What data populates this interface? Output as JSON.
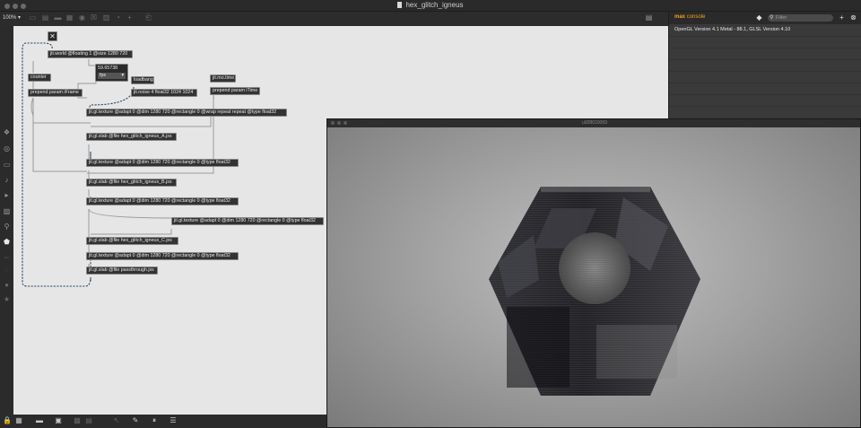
{
  "window": {
    "title": "hex_glitch_igneus"
  },
  "toolbar": {
    "zoom": "100%",
    "icons": [
      "lock-icon",
      "new-object-icon",
      "comment-icon",
      "message-icon",
      "number-icon",
      "bang-icon",
      "toggle-icon",
      "slider-icon",
      "dial-icon",
      "add-icon",
      "present-icon",
      "sidebar-icon"
    ]
  },
  "patcher": {
    "close_glyph": "✕",
    "objects": {
      "world": "jit.world @floating 1 @size 1280 720",
      "counter": "counter",
      "prepend_iframe": "prepend param iFrame",
      "number_value": "59.65738",
      "number_menu": "fps",
      "loadbang": "loadbang",
      "noise": "jit.noise 4 float32 1024 1024",
      "mo_time": "jit.mo.time",
      "prepend_itime": "prepend param iTime",
      "tex_wrap": "jit.gl.texture @adapt 0 @dim 1280 720 @rectangle 0 @wrap repeat repeat @type float32",
      "slab_a": "jit.gl.slab @file hex_glitch_igneus_A.jxs",
      "tex_1": "jit.gl.texture @adapt 0 @dim 1280 720 @rectangle 0 @type float32",
      "slab_b": "jit.gl.slab @file hex_glitch_igneus_B.jxs",
      "tex_2": "jit.gl.texture @adapt 0 @dim 1280 720 @rectangle 0 @type float32",
      "tex_3": "jit.gl.texture @adapt 0 @dim 1280 720 @rectangle 0 @type float32",
      "slab_c": "jit.gl.slab @file hex_glitch_igneus_C.jxs",
      "tex_4": "jit.gl.texture @adapt 0 @dim 1280 720 @rectangle 0 @type float32",
      "passthrough": "jit.gl.slab @file passthrough.jxs"
    }
  },
  "console": {
    "title_bold": "max",
    "title_light": "console",
    "filter_placeholder": "Filter",
    "messages": [
      "OpenGL Version 4.1 Metal - 88.1, GLSL Version 4.10"
    ]
  },
  "render_window": {
    "title": "u928010069"
  },
  "colors": {
    "canvas_bg": "#e6e6e6",
    "object_bg": "#333333",
    "console_accent": "#f0a020",
    "chrome_dark": "#2b2b2b"
  }
}
